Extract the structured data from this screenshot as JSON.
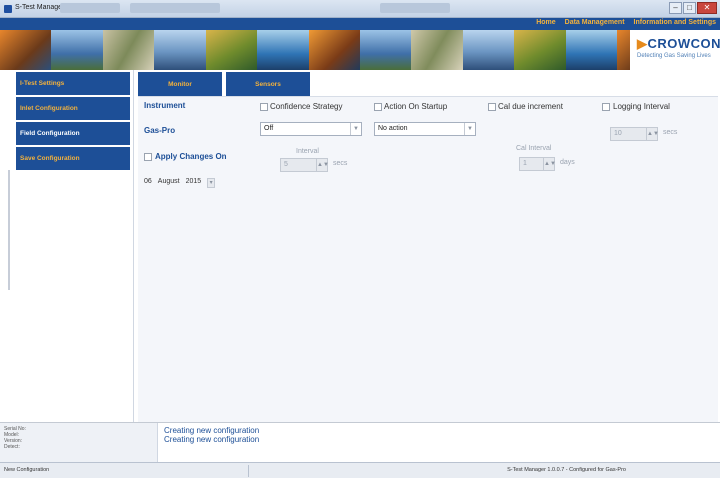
{
  "window": {
    "title": "S-Test Manager",
    "controls": {
      "minimize": "–",
      "maximize": "□",
      "close": "✕"
    }
  },
  "nav": {
    "links": [
      "Home",
      "Data Management",
      "Information and Settings"
    ]
  },
  "brand": {
    "name": "CROWCON",
    "tagline": "Detecting Gas Saving Lives",
    "colors": {
      "primary": "#1d4f97",
      "accent": "#f4b23c",
      "logo_mark": "#e68a1c"
    }
  },
  "sidebar": {
    "items": [
      {
        "label": "I-Test Settings",
        "active": false
      },
      {
        "label": "Inlet Configuration",
        "active": false
      },
      {
        "label": "Field Configuration",
        "active": true
      },
      {
        "label": "Save Configuration",
        "active": false
      }
    ]
  },
  "tabs": [
    {
      "label": "Monitor"
    },
    {
      "label": "Sensors"
    }
  ],
  "form": {
    "instrument_label": "Instrument",
    "instrument_value": "Gas-Pro",
    "apply_changes_label": "Apply Changes On",
    "date": {
      "day": "06",
      "month": "August",
      "year": "2015"
    },
    "confidence": {
      "label": "Confidence Strategy",
      "value": "Off",
      "interval_label": "Interval",
      "interval_value": "5",
      "interval_unit": "secs"
    },
    "startup": {
      "label": "Action On Startup",
      "value": "No action"
    },
    "cal_due": {
      "label": "Cal due increment",
      "interval_label": "Cal Interval",
      "interval_value": "1",
      "interval_unit": "days"
    },
    "logging": {
      "label": "Logging Interval",
      "value": "10",
      "unit": "secs"
    }
  },
  "log": {
    "info_labels": [
      "Serial No:",
      "Model:",
      "Version:",
      "Detect:"
    ],
    "messages": [
      "Creating new configuration",
      "Creating new configuration"
    ]
  },
  "status": {
    "left": "New Configuration",
    "right": "S-Test Manager 1.0.0.7 - Configured for Gas-Pro"
  }
}
